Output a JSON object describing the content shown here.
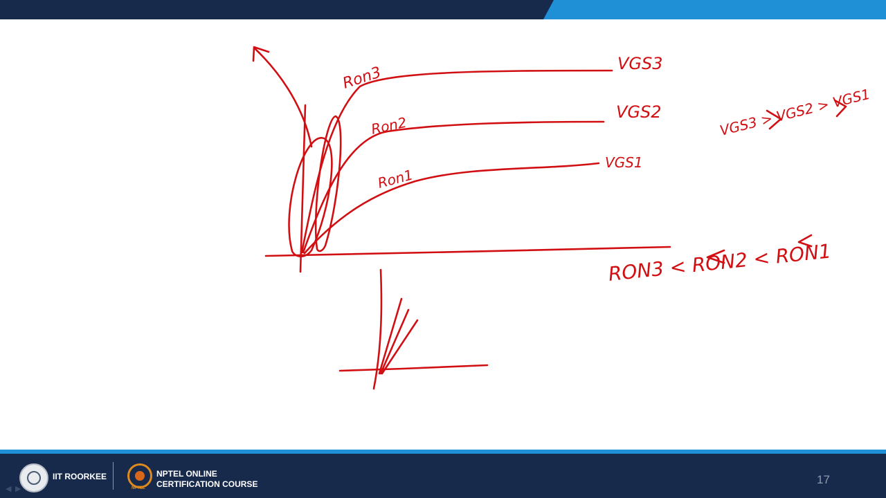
{
  "header": {
    "left_color": "#172a4c",
    "right_color": "#1f8fd6"
  },
  "ink_color": "#d10f12",
  "annotations": {
    "curve1_label": "Ron3",
    "curve2_label": "Ron2",
    "curve3_label": "Ron1",
    "vgs3": "VGS3",
    "vgs2": "VGS2",
    "vgs1": "VGS1",
    "vgs_relation": "VGS3 > VGS2 > VGS1",
    "ron_relation": "RON3 < RON2 < RON1"
  },
  "footer": {
    "institute": "IIT ROORKEE",
    "nptel_logo_label": "NPTEL",
    "course_line1": "NPTEL ONLINE",
    "course_line2": "CERTIFICATION COURSE",
    "page_number": "17",
    "bar_color": "#172a4c",
    "accent_color": "#1f8fd6"
  }
}
